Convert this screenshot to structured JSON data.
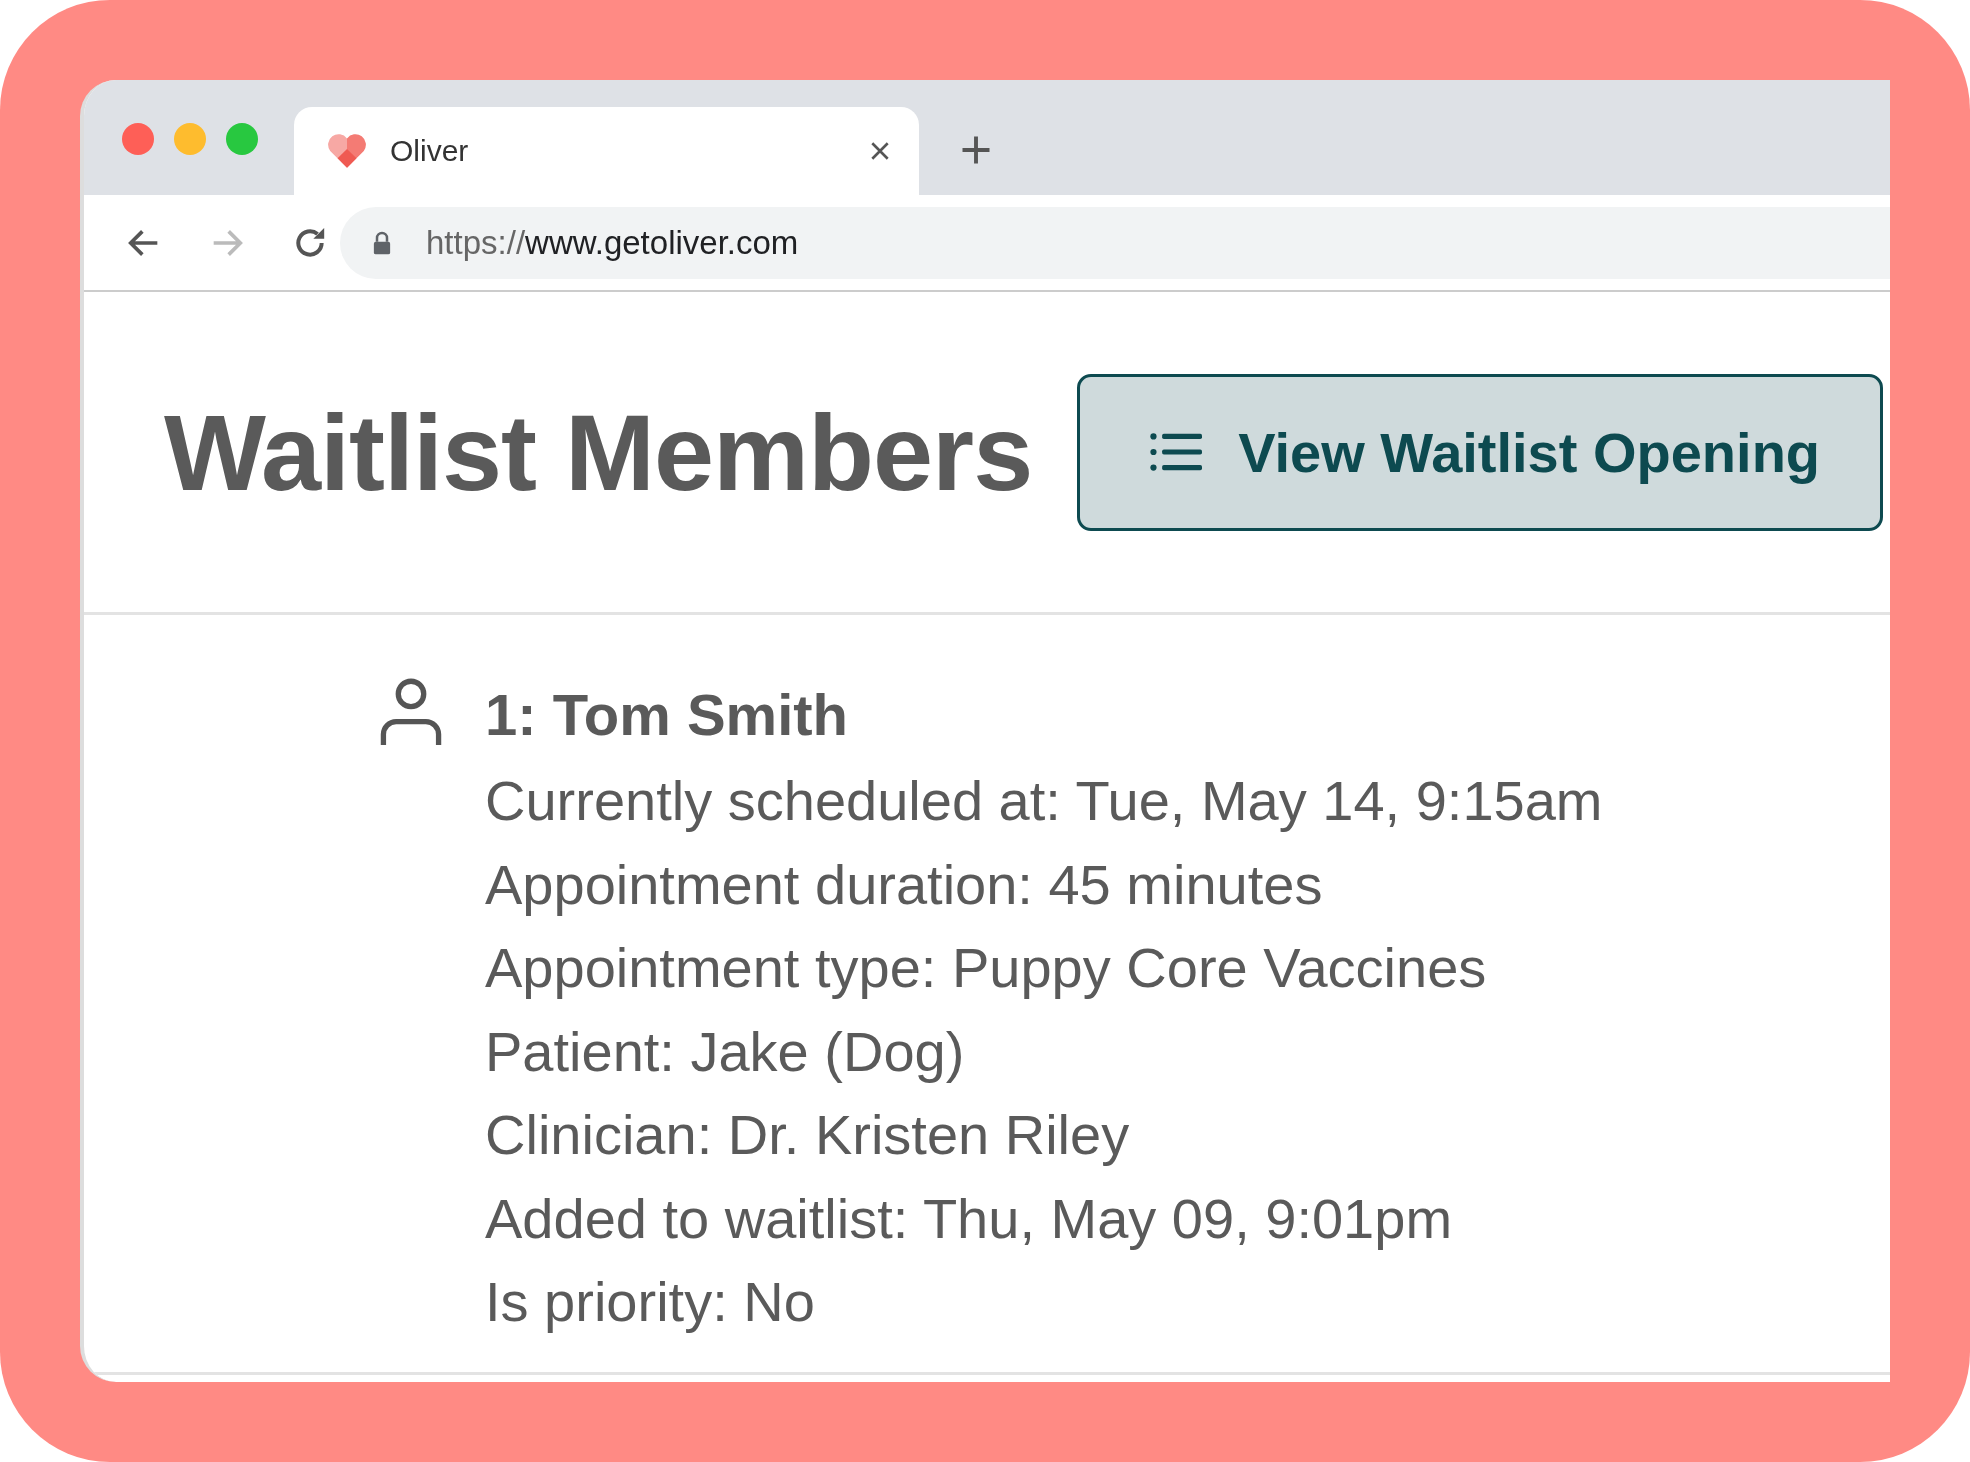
{
  "browser": {
    "tab": {
      "title": "Oliver"
    },
    "nav": {
      "back_disabled": false,
      "forward_disabled": true
    },
    "url": {
      "scheme": "https://",
      "host": "www.getoliver.com"
    }
  },
  "page": {
    "title": "Waitlist Members",
    "action_button": "View Waitlist Opening"
  },
  "members": [
    {
      "heading": "1: Tom Smith",
      "details": [
        "Currently scheduled at: Tue, May 14, 9:15am",
        "Appointment duration: 45 minutes",
        "Appointment type: Puppy Core Vaccines",
        "Patient: Jake (Dog)",
        "Clinician: Dr. Kristen Riley",
        "Added to waitlist: Thu, May 09, 9:01pm",
        "Is priority: No"
      ]
    }
  ]
}
